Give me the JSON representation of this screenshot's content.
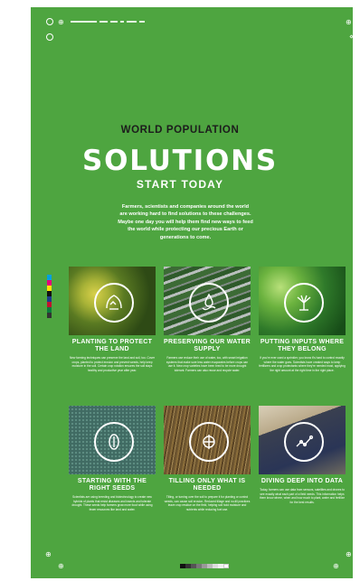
{
  "header": {
    "eyebrow": "WORLD POPULATION",
    "title": "SOLUTIONS",
    "subtitle": "START TODAY"
  },
  "intro": "Farmers, scientists and companies around the world are working hard to find solutions to these challenges. Maybe one day you will help them find new ways to feed the world while protecting our precious Earth or generations to come.",
  "cards": [
    {
      "title": "PLANTING TO PROTECT THE LAND",
      "icon": "soil-hand-icon",
      "body": "New farming techniques can preserve the land and soil, too. Cover crops, planted to protect erosion and prevent weeds, help keep moisture in the soil. Certain crop rotation ensures the soil stays healthy and productive year after year."
    },
    {
      "title": "PRESERVING OUR WATER SUPPLY",
      "icon": "water-drops-icon",
      "body": "Farmers use reduce their use of water, too, with smart irrigation systems that make sure less water evaporates before crops can use it. New crop varieties have been bred to be more drought tolerant. Farmers can also reuse and recycle water."
    },
    {
      "title": "PUTTING INPUTS WHERE THEY BELONG",
      "icon": "sprinkler-icon",
      "body": "If you're ever used a sprinkler, you know it's hard to control exactly where the water goes. Scientists have created ways to keep fertilizers and crop protectants where they're needed most, applying the right amount at the right time in the right place."
    },
    {
      "title": "STARTING WITH THE RIGHT SEEDS",
      "icon": "seed-icon",
      "body": "Scientists are using breeding and biotechnology to create new hybrids of plants that resist diseases and insects and tolerate drought. These seeds help farmers grow more food while using fewer resources like land and water."
    },
    {
      "title": "TILLING ONLY WHAT IS NEEDED",
      "icon": "tilled-soil-icon",
      "body": "Tilling, or turning over the soil to prepare it for planting or control weeds, can cause soil erosion. Reduced tillage and no-till practices leave crop residue on the field, helping soil hold moisture and nutrients while reducing fuel use."
    },
    {
      "title": "DIVING DEEP INTO DATA",
      "icon": "data-graph-icon",
      "body": "Today, farmers can use data from sensors, satellites and drones to see exactly what each part of a field needs. This information helps them know where, when and how much to plant, water and fertilize for the best results."
    }
  ],
  "colors": {
    "background": "#4ea540",
    "heading_dark": "#1c1c1c",
    "text": "#ffffff"
  }
}
